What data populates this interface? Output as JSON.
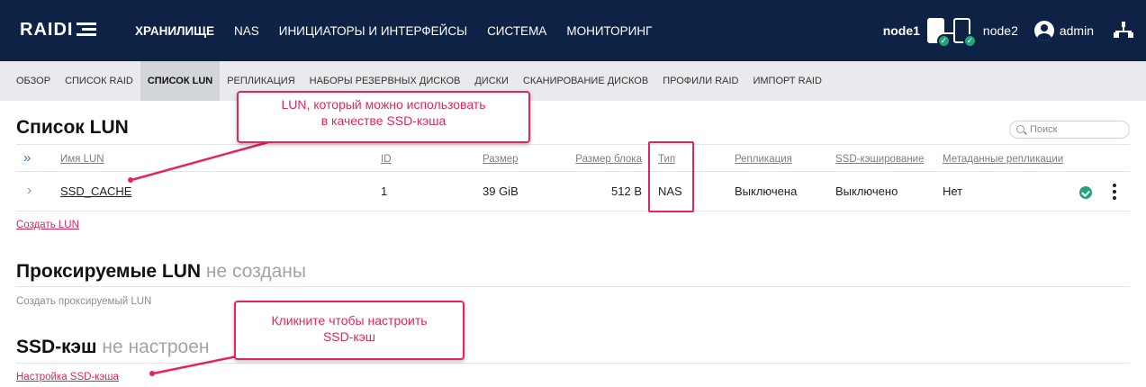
{
  "app": {
    "logo": "RAIDIX"
  },
  "nav": {
    "items": [
      "ХРАНИЛИЩЕ",
      "NAS",
      "ИНИЦИАТОРЫ И ИНТЕРФЕЙСЫ",
      "СИСТЕМА",
      "МОНИТОРИНГ"
    ],
    "active": "ХРАНИЛИЩЕ"
  },
  "header_right": {
    "node1": "node1",
    "node2": "node2",
    "user": "admin"
  },
  "subnav": {
    "items": [
      "ОБЗОР",
      "СПИСОК RAID",
      "СПИСОК LUN",
      "РЕПЛИКАЦИЯ",
      "НАБОРЫ РЕЗЕРВНЫХ ДИСКОВ",
      "ДИСКИ",
      "СКАНИРОВАНИЕ ДИСКОВ",
      "ПРОФИЛИ RAID",
      "ИМПОРТ RAID"
    ],
    "active": "СПИСОК LUN"
  },
  "lun_list": {
    "title": "Список LUN",
    "search_placeholder": "Поиск",
    "columns": {
      "name": "Имя LUN",
      "id": "ID",
      "size": "Размер",
      "block_size": "Размер блока",
      "type": "Тип",
      "replication": "Репликация",
      "ssd_caching": "SSD-кэширование",
      "replication_metadata": "Метаданные репликации"
    },
    "rows": [
      {
        "name": "SSD_CACHE",
        "id": "1",
        "size": "39 GiB",
        "block_size": "512 B",
        "type": "NAS",
        "replication": "Выключена",
        "ssd_caching": "Выключено",
        "replication_metadata": "Нет",
        "status": "ok"
      }
    ],
    "create_link": "Создать LUN"
  },
  "proxy_luns": {
    "title": "Проксируемые LUN",
    "status": "не созданы",
    "create_text": "Создать проксируемый LUN"
  },
  "ssd_cache": {
    "title": "SSD-кэш",
    "status": "не настроен",
    "setup_link": "Настройка SSD-кэша"
  },
  "callouts": {
    "lun_tip_line1": "LUN, который можно использовать",
    "lun_tip_line2": "в качестве SSD-кэша",
    "setup_tip_line1": "Кликните чтобы настроить",
    "setup_tip_line2": "SSD-кэш"
  },
  "colors": {
    "topbar": "#0d2245",
    "accent": "#e5245f",
    "status_ok": "#22a37b",
    "link": "#d9265a"
  }
}
